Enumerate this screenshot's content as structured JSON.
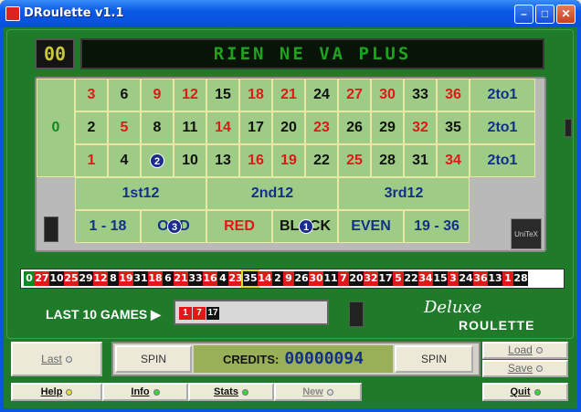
{
  "window": {
    "title": "DRoulette v1.1"
  },
  "display": {
    "zero": "00",
    "message": "RIEN NE VA PLUS"
  },
  "board": {
    "zero": "0",
    "rows": [
      [
        {
          "n": "3",
          "c": "red"
        },
        {
          "n": "6",
          "c": "black"
        },
        {
          "n": "9",
          "c": "red"
        },
        {
          "n": "12",
          "c": "red"
        },
        {
          "n": "15",
          "c": "black"
        },
        {
          "n": "18",
          "c": "red"
        },
        {
          "n": "21",
          "c": "red"
        },
        {
          "n": "24",
          "c": "black"
        },
        {
          "n": "27",
          "c": "red"
        },
        {
          "n": "30",
          "c": "red"
        },
        {
          "n": "33",
          "c": "black"
        },
        {
          "n": "36",
          "c": "red"
        }
      ],
      [
        {
          "n": "2",
          "c": "black"
        },
        {
          "n": "5",
          "c": "red"
        },
        {
          "n": "8",
          "c": "black"
        },
        {
          "n": "11",
          "c": "black"
        },
        {
          "n": "14",
          "c": "red"
        },
        {
          "n": "17",
          "c": "black"
        },
        {
          "n": "20",
          "c": "black"
        },
        {
          "n": "23",
          "c": "red"
        },
        {
          "n": "26",
          "c": "black"
        },
        {
          "n": "29",
          "c": "black"
        },
        {
          "n": "32",
          "c": "red"
        },
        {
          "n": "35",
          "c": "black"
        }
      ],
      [
        {
          "n": "1",
          "c": "red"
        },
        {
          "n": "4",
          "c": "black"
        },
        {
          "n": "",
          "c": "black",
          "chip": "2"
        },
        {
          "n": "10",
          "c": "black"
        },
        {
          "n": "13",
          "c": "black"
        },
        {
          "n": "16",
          "c": "red"
        },
        {
          "n": "19",
          "c": "red"
        },
        {
          "n": "22",
          "c": "black"
        },
        {
          "n": "25",
          "c": "red"
        },
        {
          "n": "28",
          "c": "black"
        },
        {
          "n": "31",
          "c": "black"
        },
        {
          "n": "34",
          "c": "red"
        }
      ]
    ],
    "columns": [
      "2to1",
      "2to1",
      "2to1"
    ],
    "dozens": [
      "1st12",
      "2nd12",
      "3rd12"
    ],
    "outside": [
      {
        "label": "1 - 18",
        "c": "blue"
      },
      {
        "label": "ODD",
        "c": "blue",
        "chip": "3"
      },
      {
        "label": "RED",
        "c": "red"
      },
      {
        "label": "BLACK",
        "c": "black",
        "chip": "1"
      },
      {
        "label": "EVEN",
        "c": "blue"
      },
      {
        "label": "19 - 36",
        "c": "blue"
      }
    ]
  },
  "wheel_strip": [
    {
      "n": "0",
      "c": "green"
    },
    {
      "n": "27",
      "c": "red"
    },
    {
      "n": "10",
      "c": "black"
    },
    {
      "n": "25",
      "c": "red"
    },
    {
      "n": "29",
      "c": "black"
    },
    {
      "n": "12",
      "c": "red"
    },
    {
      "n": "8",
      "c": "black"
    },
    {
      "n": "19",
      "c": "red"
    },
    {
      "n": "31",
      "c": "black"
    },
    {
      "n": "18",
      "c": "red"
    },
    {
      "n": "6",
      "c": "black"
    },
    {
      "n": "21",
      "c": "red"
    },
    {
      "n": "33",
      "c": "black"
    },
    {
      "n": "16",
      "c": "red"
    },
    {
      "n": "4",
      "c": "black"
    },
    {
      "n": "23",
      "c": "red"
    },
    {
      "n": "35",
      "c": "black",
      "active": true
    },
    {
      "n": "14",
      "c": "red"
    },
    {
      "n": "2",
      "c": "black"
    },
    {
      "n": "9",
      "c": "red"
    },
    {
      "n": "26",
      "c": "black"
    },
    {
      "n": "30",
      "c": "red"
    },
    {
      "n": "11",
      "c": "black"
    },
    {
      "n": "7",
      "c": "red"
    },
    {
      "n": "20",
      "c": "black"
    },
    {
      "n": "32",
      "c": "red"
    },
    {
      "n": "17",
      "c": "black"
    },
    {
      "n": "5",
      "c": "red"
    },
    {
      "n": "22",
      "c": "black"
    },
    {
      "n": "34",
      "c": "red"
    },
    {
      "n": "15",
      "c": "black"
    },
    {
      "n": "3",
      "c": "red"
    },
    {
      "n": "24",
      "c": "black"
    },
    {
      "n": "36",
      "c": "red"
    },
    {
      "n": "13",
      "c": "black"
    },
    {
      "n": "1",
      "c": "red"
    },
    {
      "n": "28",
      "c": "black"
    }
  ],
  "last10": {
    "label": "LAST 10 GAMES",
    "results": [
      {
        "n": "1",
        "c": "red"
      },
      {
        "n": "7",
        "c": "red"
      },
      {
        "n": "17",
        "c": "black"
      }
    ]
  },
  "brand": {
    "deluxe": "Deluxe",
    "roulette": "ROULETTE",
    "chip_label": "UniTeX"
  },
  "controls": {
    "last": "Last",
    "spin_left": "SPIN",
    "credits_label": "CREDITS:",
    "credits_value": "00000094",
    "spin_right": "SPIN",
    "load": "Load",
    "save": "Save",
    "help": "Help",
    "info": "Info",
    "stats": "Stats",
    "new": "New",
    "quit": "Quit"
  },
  "colors": {
    "felt": "#1f7a2a",
    "red": "#e01818",
    "black": "#111111",
    "green": "#0b8a1f",
    "blue": "#12308a"
  }
}
